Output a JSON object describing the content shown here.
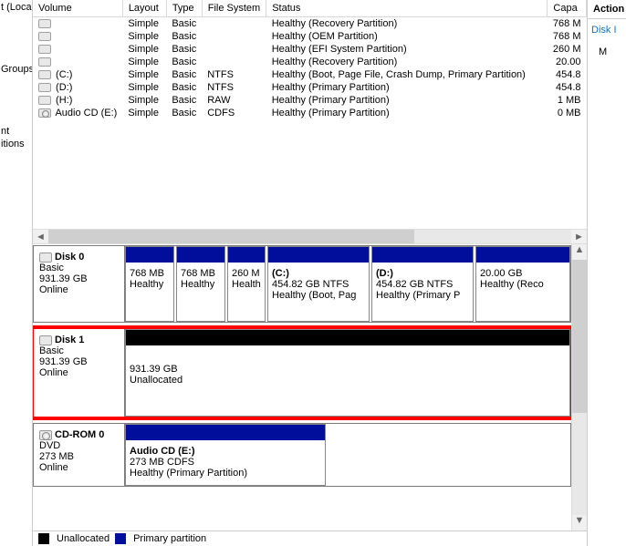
{
  "left_sidebar": {
    "item0": "t (Local",
    "item1": "Groups",
    "item2": "nt",
    "item3": "itions"
  },
  "right_panel": {
    "header": "Action",
    "item0": "Disk I",
    "item1": "M"
  },
  "columns": {
    "c0": "Volume",
    "c1": "Layout",
    "c2": "Type",
    "c3": "File System",
    "c4": "Status",
    "c5": "Capa"
  },
  "volumes": [
    {
      "icon": "disk",
      "name": "",
      "layout": "Simple",
      "type": "Basic",
      "fs": "",
      "status": "Healthy (Recovery Partition)",
      "cap": "768 M"
    },
    {
      "icon": "disk",
      "name": "",
      "layout": "Simple",
      "type": "Basic",
      "fs": "",
      "status": "Healthy (OEM Partition)",
      "cap": "768 M"
    },
    {
      "icon": "disk",
      "name": "",
      "layout": "Simple",
      "type": "Basic",
      "fs": "",
      "status": "Healthy (EFI System Partition)",
      "cap": "260 M"
    },
    {
      "icon": "disk",
      "name": "",
      "layout": "Simple",
      "type": "Basic",
      "fs": "",
      "status": "Healthy (Recovery Partition)",
      "cap": "20.00"
    },
    {
      "icon": "disk",
      "name": "(C:)",
      "layout": "Simple",
      "type": "Basic",
      "fs": "NTFS",
      "status": "Healthy (Boot, Page File, Crash Dump, Primary Partition)",
      "cap": "454.8"
    },
    {
      "icon": "disk",
      "name": "(D:)",
      "layout": "Simple",
      "type": "Basic",
      "fs": "NTFS",
      "status": "Healthy (Primary Partition)",
      "cap": "454.8"
    },
    {
      "icon": "disk",
      "name": "(H:)",
      "layout": "Simple",
      "type": "Basic",
      "fs": "RAW",
      "status": "Healthy (Primary Partition)",
      "cap": "1 MB"
    },
    {
      "icon": "cd",
      "name": "Audio CD (E:)",
      "layout": "Simple",
      "type": "Basic",
      "fs": "CDFS",
      "status": "Healthy (Primary Partition)",
      "cap": "0 MB"
    }
  ],
  "disks": {
    "d0": {
      "name": "Disk 0",
      "type": "Basic",
      "size": "931.39 GB",
      "status": "Online",
      "p0": {
        "name": "",
        "line1": "768 MB",
        "line2": "Healthy"
      },
      "p1": {
        "name": "",
        "line1": "768 MB",
        "line2": "Healthy"
      },
      "p2": {
        "name": "",
        "line1": "260 M",
        "line2": "Health"
      },
      "p3": {
        "name": "(C:)",
        "line1": "454.82 GB NTFS",
        "line2": "Healthy (Boot, Pag"
      },
      "p4": {
        "name": "(D:)",
        "line1": "454.82 GB NTFS",
        "line2": "Healthy (Primary P"
      },
      "p5": {
        "name": "",
        "line1": "20.00 GB",
        "line2": "Healthy (Reco"
      }
    },
    "d1": {
      "name": "Disk 1",
      "type": "Basic",
      "size": "931.39 GB",
      "status": "Online",
      "p0": {
        "name": "",
        "line1": "931.39 GB",
        "line2": "Unallocated"
      }
    },
    "d2": {
      "name": "CD-ROM 0",
      "type": "DVD",
      "size": "273 MB",
      "status": "Online",
      "p0": {
        "name": "Audio CD  (E:)",
        "line1": "273 MB CDFS",
        "line2": "Healthy (Primary Partition)"
      }
    }
  },
  "legend": {
    "l0": "Unallocated",
    "l1": "Primary partition"
  }
}
